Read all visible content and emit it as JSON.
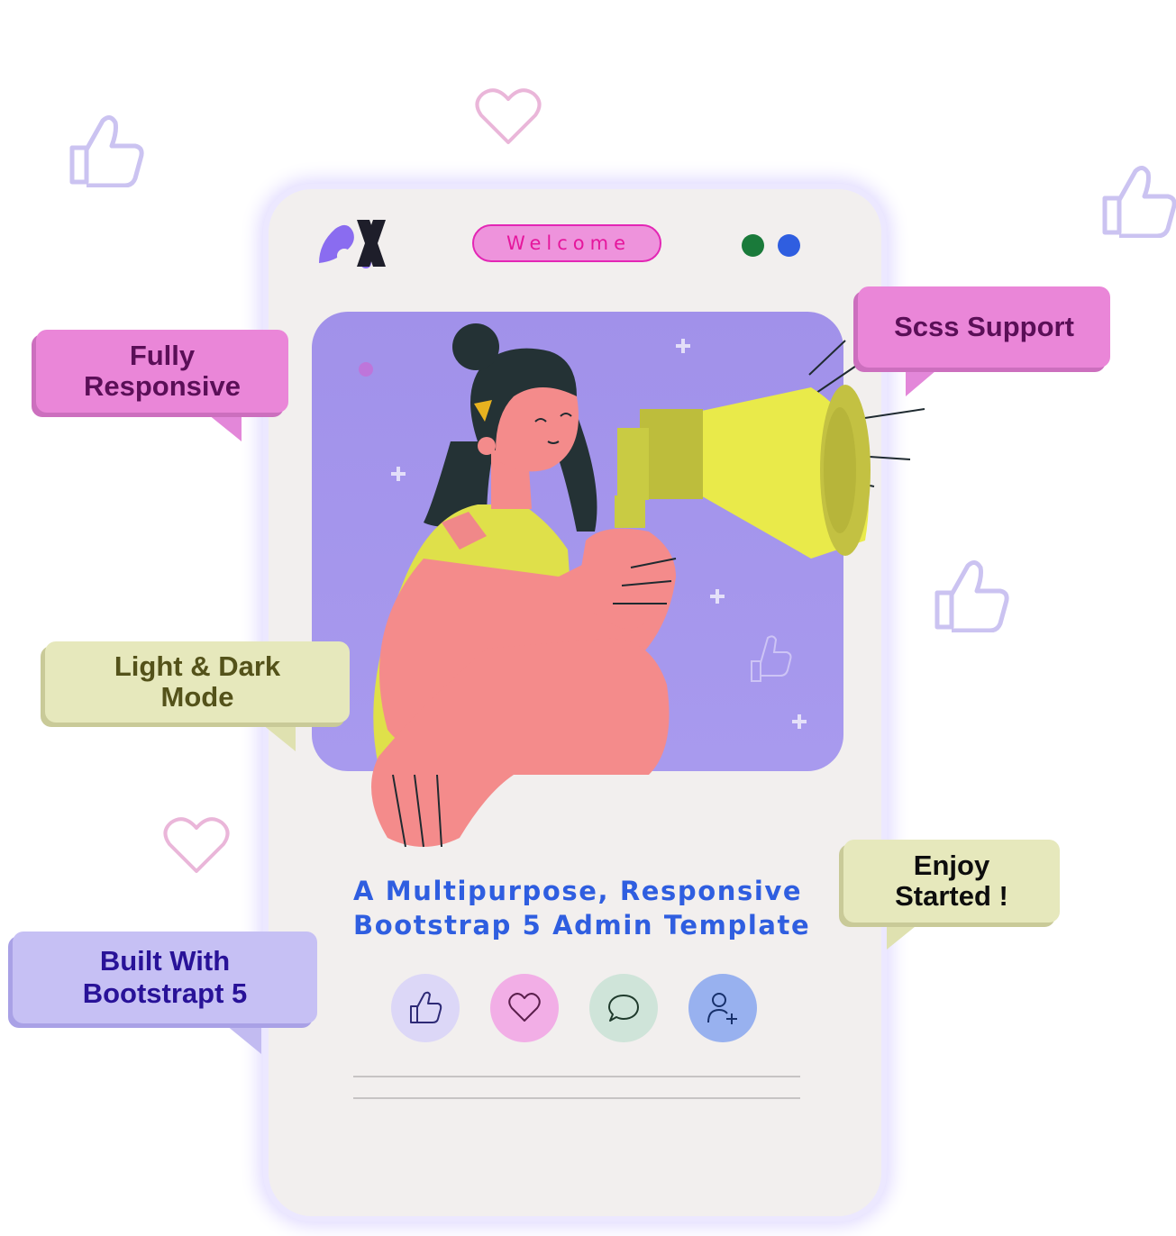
{
  "header": {
    "welcome_label": "Welcome",
    "window_dots": [
      "#1a7a3a",
      "#2f5ee0"
    ]
  },
  "headline": {
    "line1": "A Multipurpose, Responsive",
    "line2": "Bootstrap 5 Admin Template"
  },
  "callouts": {
    "fully_responsive": [
      "Fully",
      "Responsive"
    ],
    "scss_support": [
      "Scss Support"
    ],
    "light_dark": [
      "Light & Dark",
      "Mode"
    ],
    "enjoy": [
      "Enjoy",
      "Started !"
    ],
    "built_with": [
      "Built With",
      "Bootstrapt 5"
    ]
  },
  "actions": [
    {
      "icon": "thumbs-up-icon",
      "bg": "#dcd7f7"
    },
    {
      "icon": "heart-icon",
      "bg": "#f2aee6"
    },
    {
      "icon": "chat-bubble-icon",
      "bg": "#cfe4d9"
    },
    {
      "icon": "add-user-icon",
      "bg": "#98b1ef"
    }
  ],
  "colors": {
    "accent": "#2f5ee0",
    "pink": "#ea86d8",
    "purple_panel": "#a99aec",
    "olive": "#e6e8bc",
    "lilac": "#c6c0f4"
  }
}
